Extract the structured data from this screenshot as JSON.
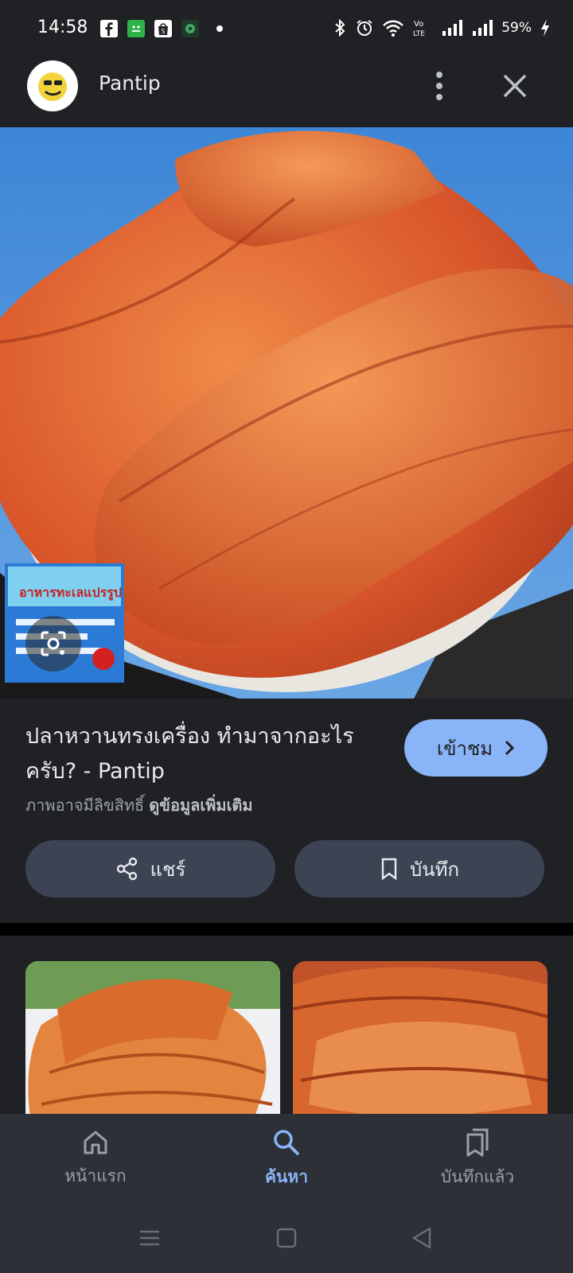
{
  "status_bar": {
    "time": "14:58",
    "battery": "59%",
    "app_icons": [
      "facebook-icon",
      "wechat-icon",
      "shopee-icon",
      "line-icon"
    ],
    "system_icons": [
      "bluetooth-icon",
      "alarm-icon",
      "wifi-icon",
      "volte-icon",
      "signal-icon",
      "signal-icon",
      "charging-icon"
    ]
  },
  "header": {
    "site_name": "Pantip",
    "icons": [
      "pantip-logo",
      "more-vert-icon",
      "close-icon"
    ]
  },
  "result": {
    "title": "ปลาหวานทรงเครื่อง ทำมาจากอะไรครับ? - Pantip",
    "visit_label": "เข้าชม",
    "copyright_notice": "ภาพอาจมีลิขสิทธิ์",
    "more_info_link": "ดูข้อมูลเพิ่มเติม",
    "share_label": "แชร์",
    "save_label": "บันทึก"
  },
  "bottom_nav": {
    "items": [
      {
        "label": "หน้าแรก",
        "icon": "home-icon",
        "active": false
      },
      {
        "label": "ค้นหา",
        "icon": "search-icon",
        "active": true
      },
      {
        "label": "บันทึกแล้ว",
        "icon": "saved-collections-icon",
        "active": false
      }
    ]
  },
  "colors": {
    "background": "#202124",
    "accent": "#8ab4f8",
    "button": "#3c4454",
    "nav_background": "#2d3036"
  }
}
